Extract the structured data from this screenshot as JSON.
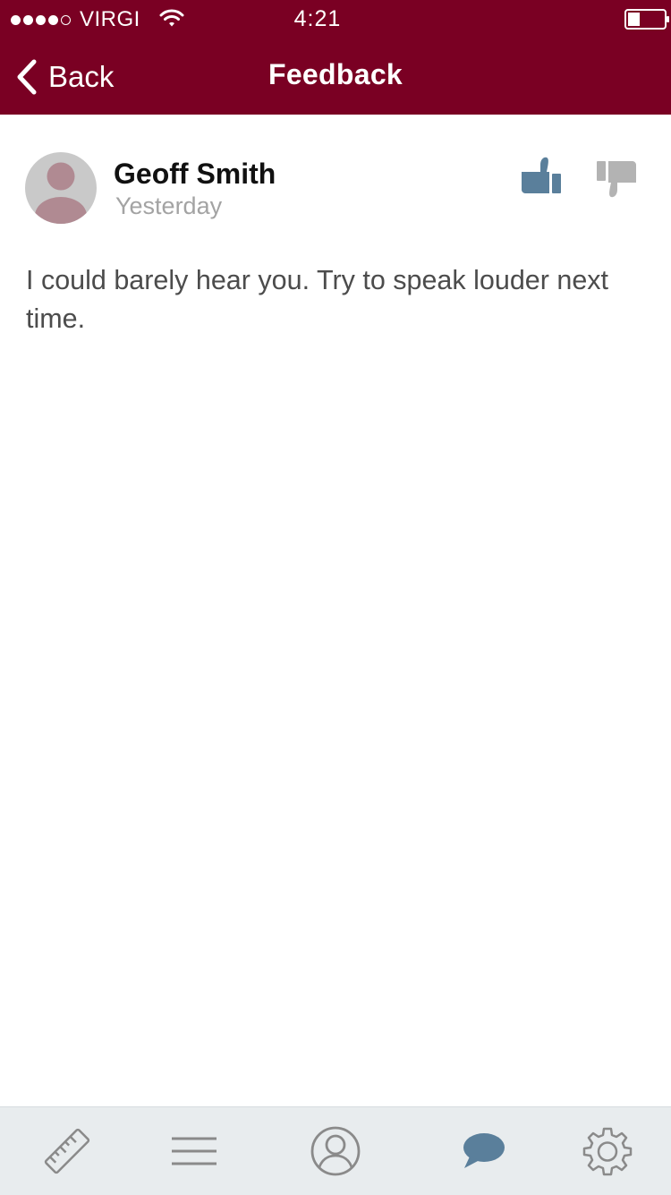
{
  "status_bar": {
    "carrier": "VIRGI",
    "signal_bars_filled": 4,
    "signal_bars_total": 5,
    "time": "4:21",
    "battery_level": 0.3
  },
  "nav": {
    "back_label": "Back",
    "title": "Feedback"
  },
  "feedback": {
    "author": "Geoff Smith",
    "time": "Yesterday",
    "text": "I could barely hear you. Try to speak louder next time.",
    "rating": "thumbs-up"
  },
  "colors": {
    "header_bg": "#7a0023",
    "accent": "#5a7f9b",
    "inactive_icon": "#9a9a9a",
    "tab_bar_bg": "#e8ecee"
  },
  "tab_bar": {
    "active": "feedback",
    "tabs": [
      {
        "id": "measure",
        "icon": "ruler-icon"
      },
      {
        "id": "menu",
        "icon": "menu-icon"
      },
      {
        "id": "profile",
        "icon": "profile-icon"
      },
      {
        "id": "feedback",
        "icon": "chat-bubble-icon"
      },
      {
        "id": "settings",
        "icon": "gear-icon"
      }
    ]
  }
}
